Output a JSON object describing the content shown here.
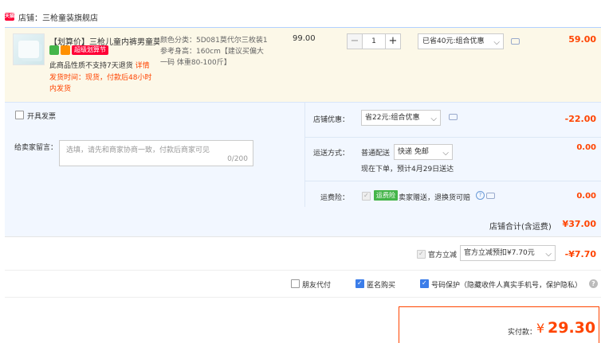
{
  "shop": {
    "logo_text": "天猫",
    "label": "店铺：三枪童装旗舰店"
  },
  "item": {
    "title": "【划算价】三枪儿童内裤男童莫…",
    "badge_super": "超级划算节",
    "policy_text": "此商品性质不支持7天退货",
    "policy_link": "详情",
    "shipping_line1": "发货时间：现货，付款后48小时",
    "shipping_line2": "内发货",
    "sku_line1": "颜色分类：5D081莫代尔三枚装1",
    "sku_line2": "参考身高：160cm【建议买偏大",
    "sku_line3": "一码 体重80-100斤】",
    "unit_price": "99.00",
    "quantity": "1",
    "qty_minus": "−",
    "qty_plus": "+",
    "discount_select": "已省40元:组合优惠",
    "total": "59.00"
  },
  "options": {
    "invoice_label": "开具发票",
    "message_label": "给卖家留言：",
    "message_placeholder": "选填，请先和商家协商一致，付款后商家可见",
    "message_count": "0/200",
    "coupon_label": "店铺优惠：",
    "coupon_select": "省22元:组合优惠",
    "coupon_amount": "-22.00",
    "shipping_label": "运送方式：",
    "shipping_type": "普通配送",
    "shipping_select": "快递 免邮",
    "shipping_note": "现在下单，预计4月29日送达",
    "shipping_amount": "0.00",
    "insurance_label": "运费险：",
    "insurance_tag": "运费险",
    "insurance_text": "卖家赠送，退换货可赔",
    "insurance_help": "?",
    "insurance_amount": "0.00"
  },
  "shop_total": {
    "label": "店铺合计(含运费)",
    "value": "¥37.00"
  },
  "gov_subsidy": {
    "label": "官方立减",
    "select": "官方立减预扣¥7.70元",
    "amount": "-¥7.70"
  },
  "extras": {
    "friend_pay": "朋友代付",
    "anonymous": "匿名购买",
    "privacy": "号码保护（隐藏收件人真实手机号，保护隐私）",
    "help": "?"
  },
  "payment": {
    "label": "实付款：",
    "currency": "¥",
    "amount": "29.30"
  },
  "colors": {
    "accent": "#ff4400",
    "tmall_red": "#ff0036",
    "selected_bg": "#fcf8e8",
    "panel_bg": "#f2f7ff",
    "checkbox_blue": "#3b7de9"
  },
  "icons": [
    "tmall-logo-icon",
    "message-icon",
    "chevron-down-icon",
    "help-icon",
    "checkbox-icon"
  ]
}
